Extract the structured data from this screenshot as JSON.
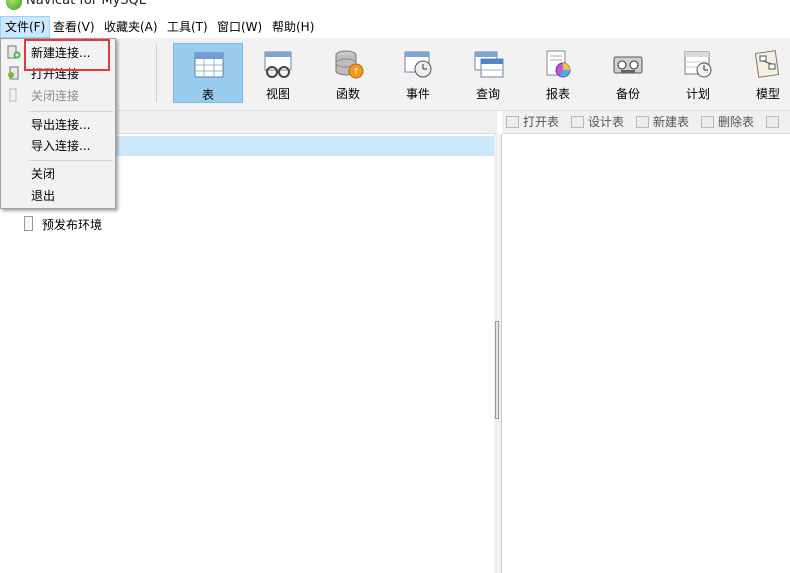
{
  "window": {
    "title": "Navicat for MySQL"
  },
  "menubar": {
    "items": [
      "文件(F)",
      "查看(V)",
      "收藏夹(A)",
      "工具(T)",
      "窗口(W)",
      "帮助(H)"
    ]
  },
  "toolbar": {
    "buttons": [
      {
        "label": "表",
        "icon": "table-icon"
      },
      {
        "label": "视图",
        "icon": "view-icon"
      },
      {
        "label": "函数",
        "icon": "function-icon"
      },
      {
        "label": "事件",
        "icon": "event-icon"
      },
      {
        "label": "查询",
        "icon": "query-icon"
      },
      {
        "label": "报表",
        "icon": "report-icon"
      },
      {
        "label": "备份",
        "icon": "backup-icon"
      },
      {
        "label": "计划",
        "icon": "schedule-icon"
      },
      {
        "label": "模型",
        "icon": "model-icon"
      }
    ]
  },
  "file_menu": {
    "items": [
      {
        "label": "新建连接...",
        "enabled": true
      },
      {
        "label": "打开连接",
        "enabled": true
      },
      {
        "label": "关闭连接",
        "enabled": false
      },
      {
        "label": "导出连接...",
        "enabled": true
      },
      {
        "label": "导入连接...",
        "enabled": true
      },
      {
        "label": "关闭",
        "enabled": true
      },
      {
        "label": "退出",
        "enabled": true
      }
    ]
  },
  "connections": {
    "items": [
      "预发布环境"
    ]
  },
  "object_toolbar": {
    "buttons": [
      "打开表",
      "设计表",
      "新建表",
      "删除表"
    ]
  },
  "colors": {
    "active_tab": "#99ccee",
    "menu_highlight": "#cce8ff",
    "annotation_box": "#e4393c"
  }
}
